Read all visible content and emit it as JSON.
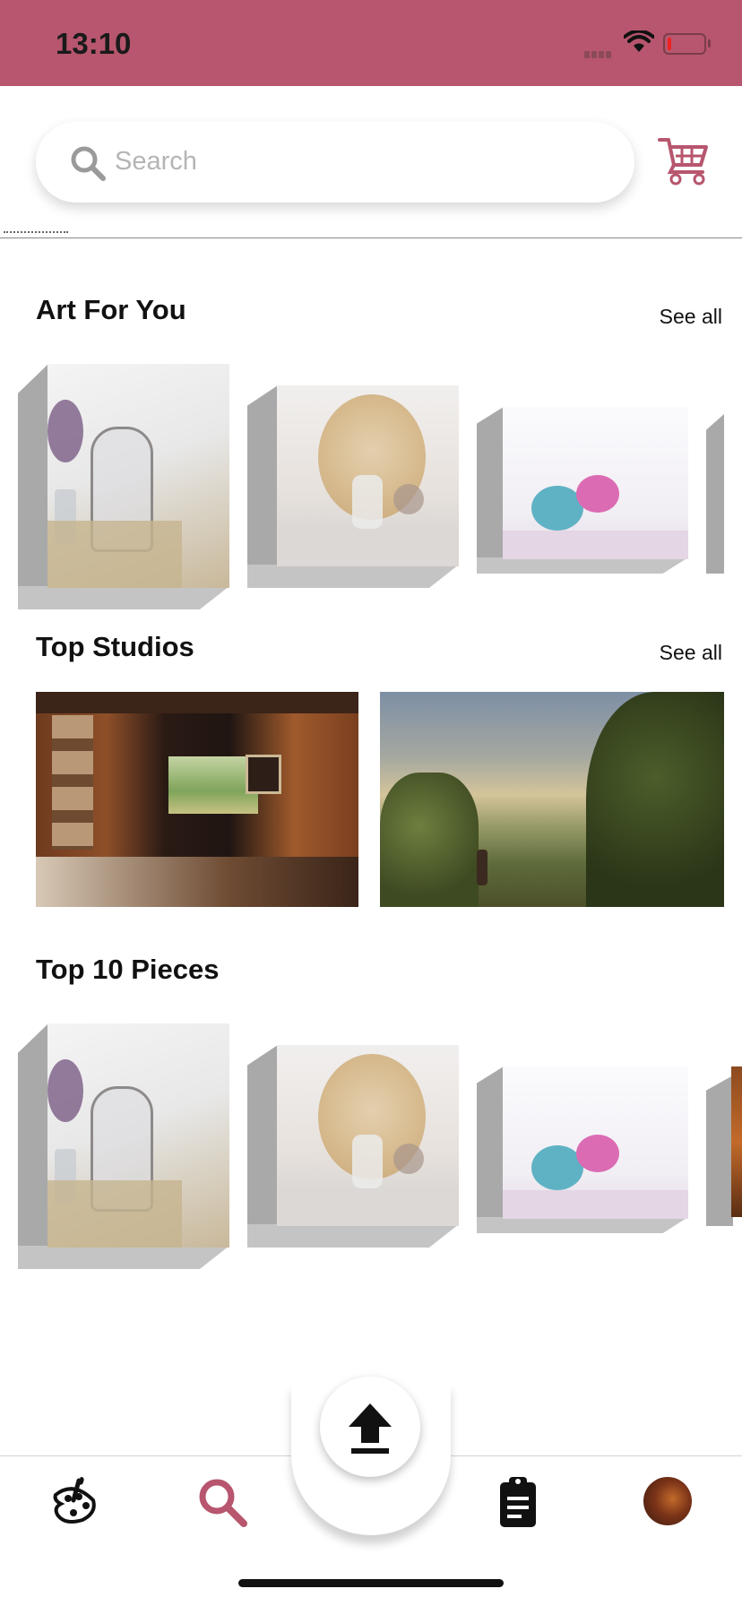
{
  "status_bar": {
    "time": "13:10",
    "battery_level": 0.05,
    "bg_color": "#b7566e"
  },
  "search": {
    "placeholder": "Search"
  },
  "accent_color": "#b7566e",
  "sections": {
    "art_for_you": {
      "title": "Art For You",
      "see_all_label": "See all"
    },
    "top_studios": {
      "title": "Top Studios",
      "see_all_label": "See all"
    },
    "top_pieces": {
      "title": "Top 10 Pieces"
    }
  },
  "artworks": [
    "still-life-vase-lavender",
    "still-life-dried-flowers",
    "yarn-balls"
  ],
  "studios": [
    "log-cabin-art-studio",
    "landscape-painting"
  ],
  "tab_bar": {
    "items": [
      "paint-palette-icon",
      "search-icon",
      "upload-icon",
      "clipboard-icon",
      "profile-avatar"
    ],
    "active": "search-icon"
  }
}
